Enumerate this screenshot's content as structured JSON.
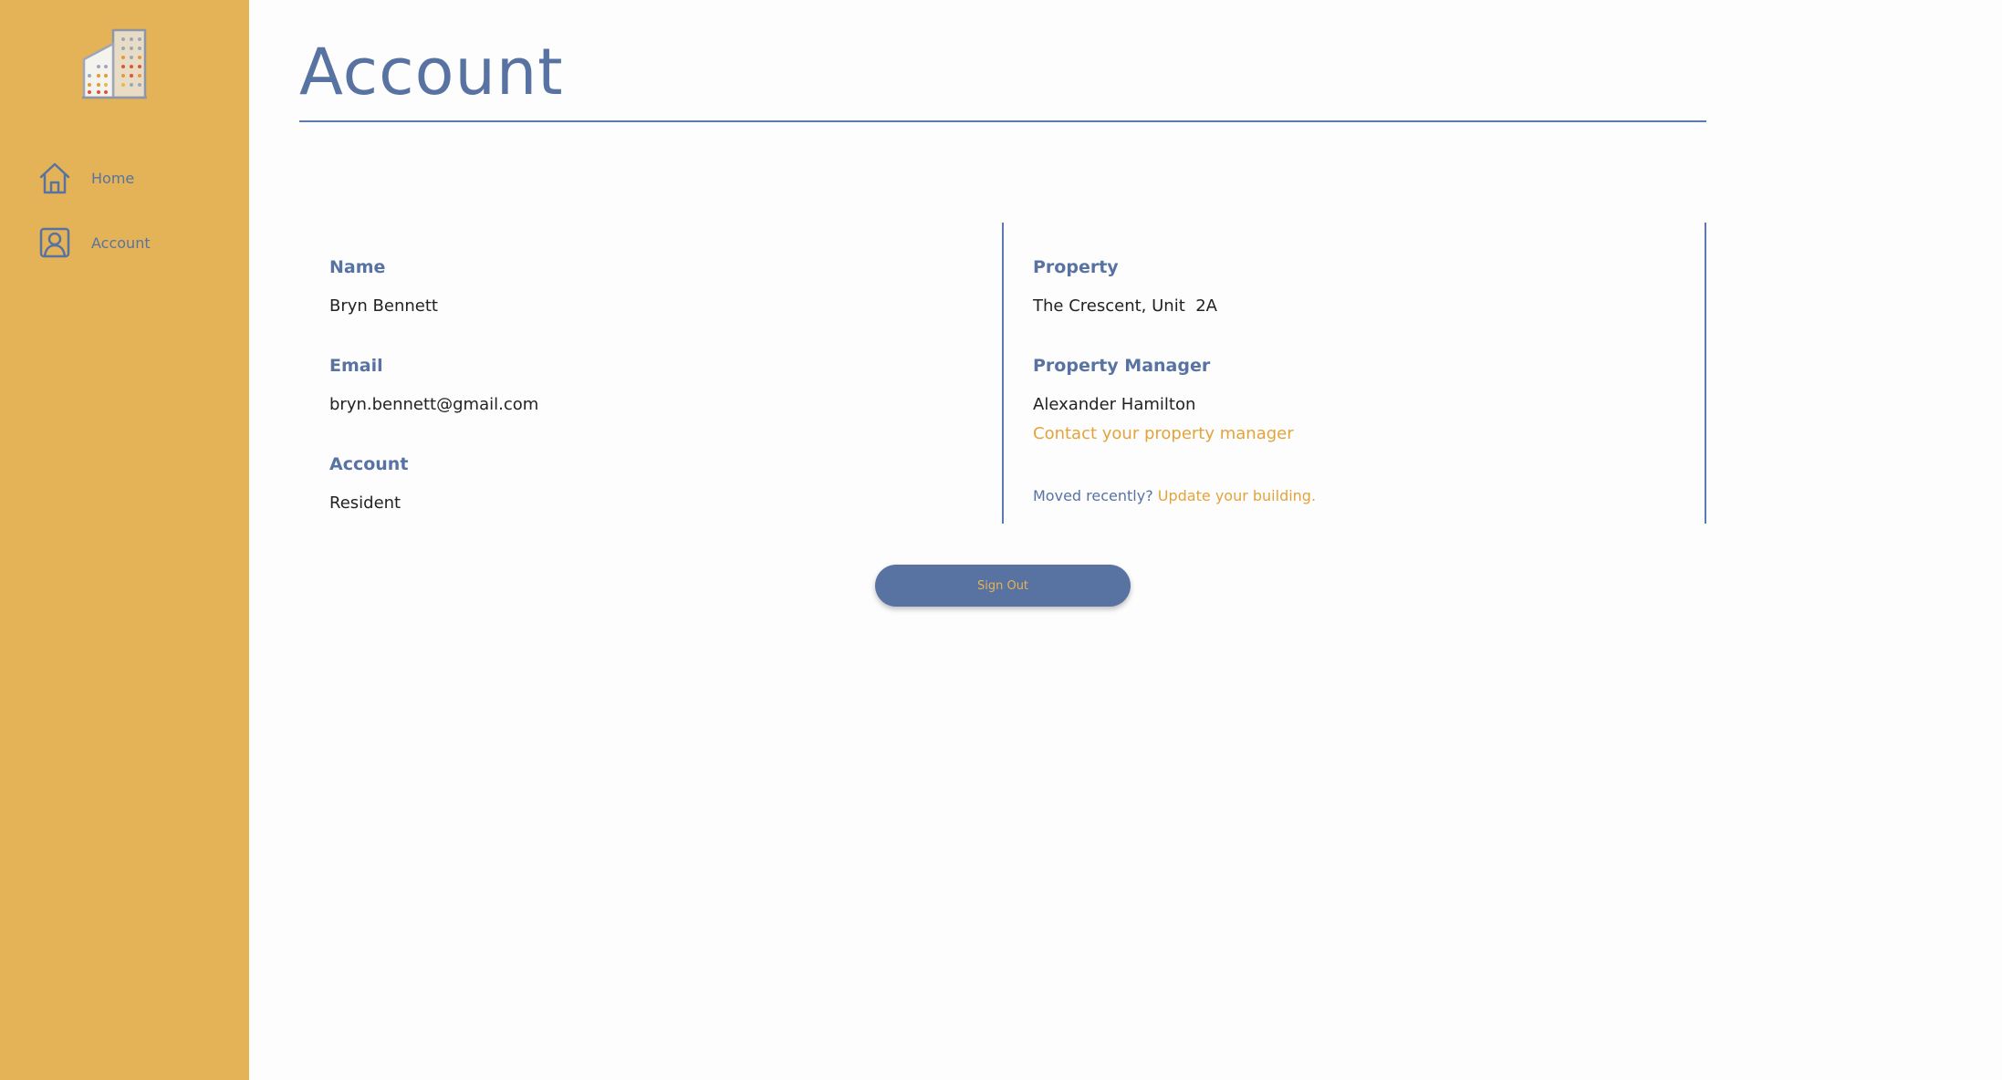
{
  "sidebar": {
    "logo_icon": "building-logo-icon",
    "items": [
      {
        "label": "Home",
        "icon": "home-icon"
      },
      {
        "label": "Account",
        "icon": "user-icon"
      }
    ]
  },
  "page": {
    "title": "Account"
  },
  "left_panel": {
    "name_label": "Name",
    "name_value": "Bryn Bennett",
    "email_label": "Email",
    "email_value": "bryn.bennett@gmail.com",
    "account_label": "Account",
    "account_value": "Resident"
  },
  "right_panel": {
    "property_label": "Property",
    "property_value": "The Crescent, Unit  2A",
    "manager_label": "Property Manager",
    "manager_value": "Alexander Hamilton",
    "contact_link": "Contact your property manager",
    "moved_text": "Moved recently?",
    "update_link": "Update your building."
  },
  "actions": {
    "sign_out_label": "Sign Out"
  },
  "colors": {
    "sidebar_bg": "#e4b357",
    "primary": "#5873a2",
    "accent": "#e3a33a",
    "text": "#222222",
    "background": "#fdfdfd"
  }
}
